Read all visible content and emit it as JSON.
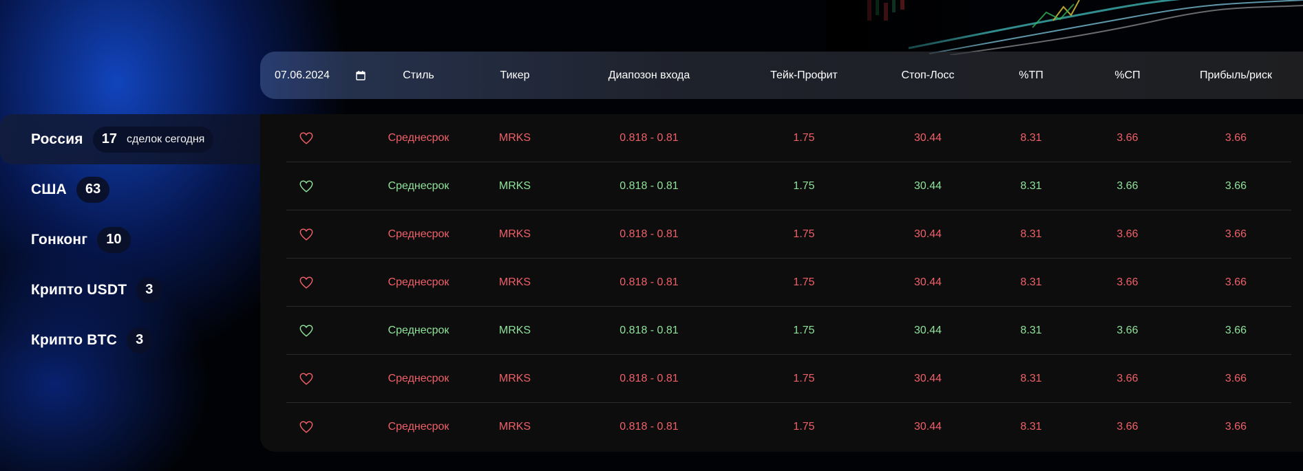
{
  "colors": {
    "loss_red": "#f06068",
    "profit_green": "#8fe39a",
    "accent_blue": "#1450dc"
  },
  "sidebar": {
    "items": [
      {
        "label": "Россия",
        "count": "17",
        "suffix": "сделок сегодня",
        "active": true
      },
      {
        "label": "США",
        "count": "63"
      },
      {
        "label": "Гонконг",
        "count": "10"
      },
      {
        "label": "Крипто USDT",
        "count": "3"
      },
      {
        "label": "Крипто BTC",
        "count": "3"
      }
    ]
  },
  "table": {
    "date": "07.06.2024",
    "date_icon": "calendar-icon",
    "columns": [
      "Стиль",
      "Тикер",
      "Диапозон входа",
      "Тейк-Профит",
      "Стоп-Лосс",
      "%ТП",
      "%СП",
      "Прибыль/риск"
    ],
    "rows": [
      {
        "status": "red",
        "style": "Среднесрок",
        "ticker": "MRKS",
        "entry": "0.818 - 0.81",
        "tp": "1.75",
        "sl": "30.44",
        "tp_pct": "8.31",
        "sl_pct": "3.66",
        "pr": "3.66"
      },
      {
        "status": "green",
        "style": "Среднесрок",
        "ticker": "MRKS",
        "entry": "0.818 - 0.81",
        "tp": "1.75",
        "sl": "30.44",
        "tp_pct": "8.31",
        "sl_pct": "3.66",
        "pr": "3.66"
      },
      {
        "status": "red",
        "style": "Среднесрок",
        "ticker": "MRKS",
        "entry": "0.818 - 0.81",
        "tp": "1.75",
        "sl": "30.44",
        "tp_pct": "8.31",
        "sl_pct": "3.66",
        "pr": "3.66"
      },
      {
        "status": "red",
        "style": "Среднесрок",
        "ticker": "MRKS",
        "entry": "0.818 - 0.81",
        "tp": "1.75",
        "sl": "30.44",
        "tp_pct": "8.31",
        "sl_pct": "3.66",
        "pr": "3.66"
      },
      {
        "status": "green",
        "style": "Среднесрок",
        "ticker": "MRKS",
        "entry": "0.818 - 0.81",
        "tp": "1.75",
        "sl": "30.44",
        "tp_pct": "8.31",
        "sl_pct": "3.66",
        "pr": "3.66"
      },
      {
        "status": "red",
        "style": "Среднесрок",
        "ticker": "MRKS",
        "entry": "0.818 - 0.81",
        "tp": "1.75",
        "sl": "30.44",
        "tp_pct": "8.31",
        "sl_pct": "3.66",
        "pr": "3.66"
      },
      {
        "status": "red",
        "style": "Среднесрок",
        "ticker": "MRKS",
        "entry": "0.818 - 0.81",
        "tp": "1.75",
        "sl": "30.44",
        "tp_pct": "8.31",
        "sl_pct": "3.66",
        "pr": "3.66"
      }
    ],
    "favorite_icon": "heart-icon"
  }
}
